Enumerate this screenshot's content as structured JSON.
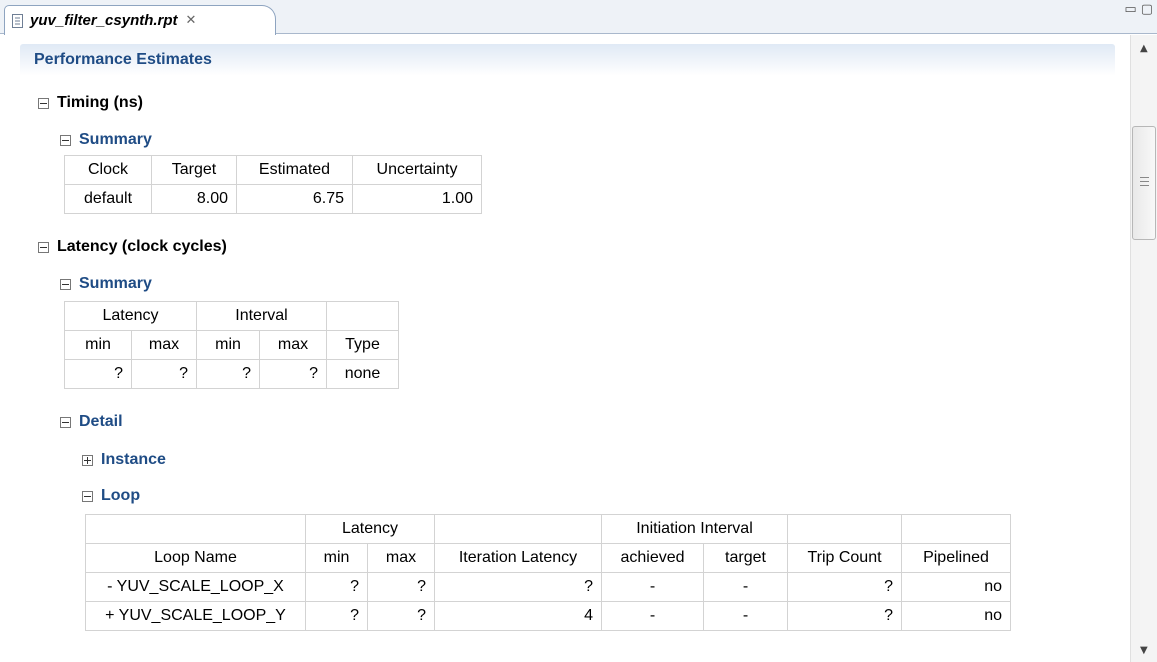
{
  "tab": {
    "title": "yuv_filter_csynth.rpt",
    "close_glyph": "✕"
  },
  "window_controls": {
    "minimize": "▭",
    "maximize": "▢"
  },
  "header": {
    "title": "Performance Estimates"
  },
  "timing": {
    "title": "Timing (ns)",
    "summary": {
      "title": "Summary",
      "columns": [
        "Clock",
        "Target",
        "Estimated",
        "Uncertainty"
      ],
      "row": [
        "default",
        "8.00",
        "6.75",
        "1.00"
      ]
    }
  },
  "latency": {
    "title": "Latency (clock cycles)",
    "summary": {
      "title": "Summary",
      "group_headers": [
        "Latency",
        "Interval",
        ""
      ],
      "columns": [
        "min",
        "max",
        "min",
        "max",
        "Type"
      ],
      "row": [
        "?",
        "?",
        "?",
        "?",
        "none"
      ]
    },
    "detail": {
      "title": "Detail",
      "instance": {
        "title": "Instance"
      },
      "loop": {
        "title": "Loop",
        "group_headers": [
          "Latency",
          "Initiation Interval"
        ],
        "columns": [
          "Loop Name",
          "min",
          "max",
          "Iteration Latency",
          "achieved",
          "target",
          "Trip Count",
          "Pipelined"
        ],
        "rows": [
          [
            "- YUV_SCALE_LOOP_X",
            "?",
            "?",
            "?",
            "-",
            "-",
            "?",
            "no"
          ],
          [
            "+ YUV_SCALE_LOOP_Y",
            "?",
            "?",
            "4",
            "-",
            "-",
            "?",
            "no"
          ]
        ]
      }
    }
  }
}
